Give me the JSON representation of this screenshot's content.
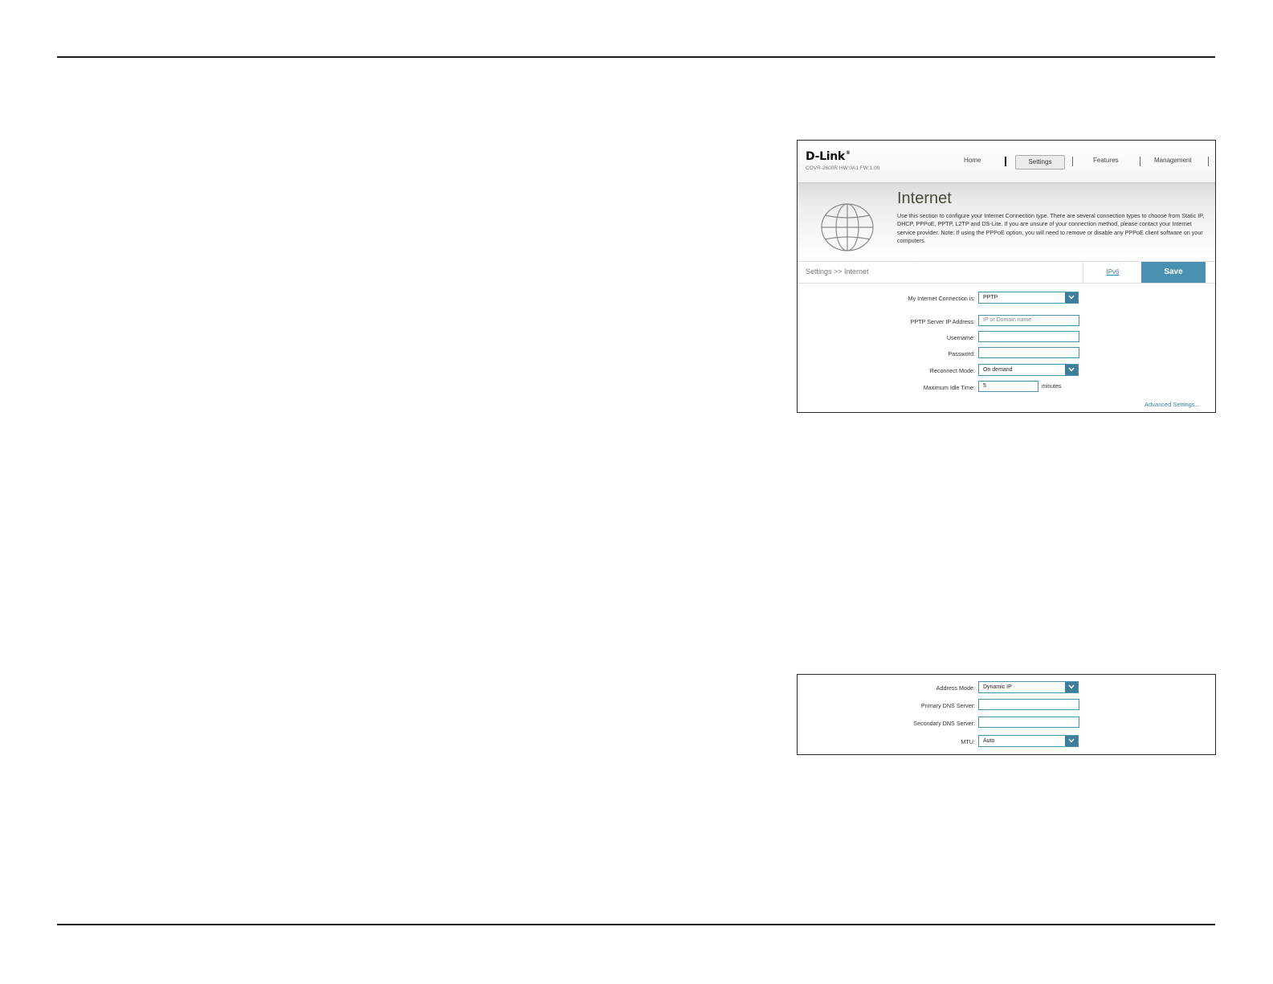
{
  "header": {
    "logo": "D-Link",
    "logo_mark": "®",
    "model": "COVR-2600R HW:0A1 FW:1.00",
    "nav": {
      "home": "Home",
      "settings": "Settings",
      "features": "Features",
      "management": "Management"
    }
  },
  "banner": {
    "title": "Internet",
    "description": "Use this section to configure your Internet Connection type. There are several connection types to choose from Static IP, DHCP, PPPoE, PPTP, L2TP and DS-Lite. If you are unsure of your connection method, please contact your Internet service provider. Note: If using the PPPoE option, you will need to remove or disable any PPPoE client software on your computers."
  },
  "breadcrumb": "Settings >> Internet",
  "ipv6_link": "IPv6",
  "save_button": "Save",
  "form": {
    "connection_label": "My Internet Connection is:",
    "connection_value": "PPTP",
    "server_label": "PPTP Server IP Address:",
    "server_placeholder": "IP or Domain name",
    "username_label": "Username:",
    "username_value": "",
    "password_label": "Password:",
    "password_value": "",
    "reconnect_label": "Reconnect Mode:",
    "reconnect_value": "On demand",
    "idle_label": "Maximum Idle Time:",
    "idle_value": "5",
    "idle_unit": "minutes",
    "advanced_link": "Advanced Settings..."
  },
  "advanced": {
    "address_mode_label": "Address Mode:",
    "address_mode_value": "Dynamic IP",
    "primary_dns_label": "Primary DNS Server:",
    "primary_dns_value": "",
    "secondary_dns_label": "Secondary DNS Server:",
    "secondary_dns_value": "",
    "mtu_label": "MTU:",
    "mtu_value": "Auto"
  },
  "colors": {
    "accent": "#4a90b0",
    "accent_dark": "#3d7e9c",
    "link": "#3a7fb0"
  }
}
